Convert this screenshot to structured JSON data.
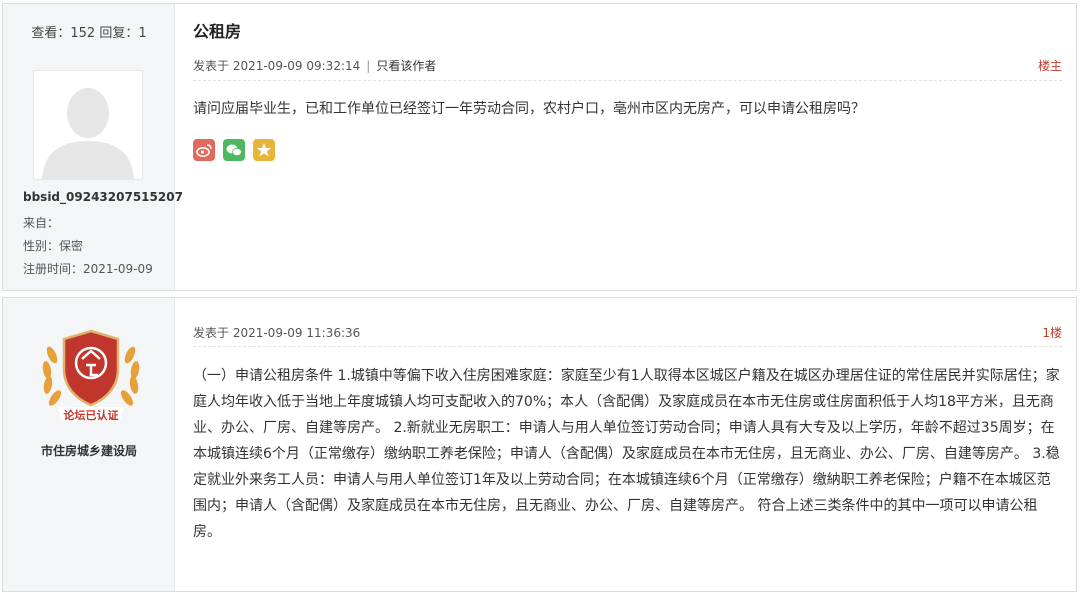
{
  "posts": [
    {
      "author": {
        "stats": "查看：152 回复：1",
        "username": "bbsid_09243207515207",
        "from": "来自：",
        "gender": "性别：保密",
        "registered": "注册时间：2021-09-09"
      },
      "title": "公租房",
      "meta": {
        "posted": "发表于 2021-09-09 09:32:14",
        "separator": "|",
        "author_only": "只看该作者"
      },
      "floor": "楼主",
      "content": "请问应届毕业生，已和工作单位已经签订一年劳动合同，农村户口，亳州市区内无房产，可以申请公租房吗？",
      "share_icons": [
        "weibo-icon",
        "wechat-icon",
        "favorite-star-icon"
      ],
      "share_colors": [
        "#e06a5d",
        "#4fb760",
        "#e9b43a"
      ]
    },
    {
      "author": {
        "badge_text": "论坛已认证",
        "name": "市住房城乡建设局"
      },
      "meta": {
        "posted": "发表于 2021-09-09 11:36:36"
      },
      "floor": "1楼",
      "content": "（一）申请公租房条件 1.城镇中等偏下收入住房困难家庭：家庭至少有1人取得本区城区户籍及在城区办理居住证的常住居民并实际居住；家庭人均年收入低于当地上年度城镇人均可支配收入的70%；本人（含配偶）及家庭成员在本市无住房或住房面积低于人均18平方米，且无商业、办公、厂房、自建等房产。 2.新就业无房职工：申请人与用人单位签订劳动合同；申请人具有大专及以上学历，年龄不超过35周岁；在本城镇连续6个月（正常缴存）缴纳职工养老保险；申请人（含配偶）及家庭成员在本市无住房，且无商业、办公、厂房、自建等房产。 3.稳定就业外来务工人员：申请人与用人单位签订1年及以上劳动合同；在本城镇连续6个月（正常缴存）缴納职工养老保险；户籍不在本城区范围内；申请人（含配偶）及家庭成员在本市无住房，且无商业、办公、厂房、自建等房产。 符合上述三类条件中的其中一项可以申请公租房。"
    }
  ]
}
